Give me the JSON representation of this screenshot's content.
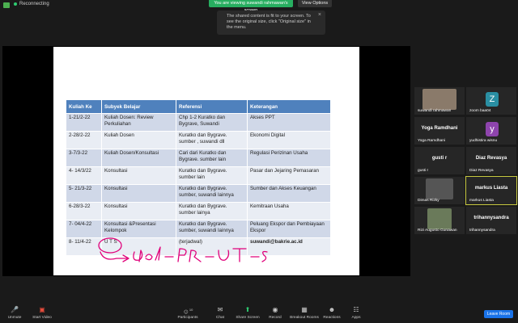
{
  "topbar": {
    "status": "Reconnecting",
    "viewing": "You are viewing suwandi rahmawan's screen",
    "view_options": "View Options"
  },
  "tooltip": {
    "text": "The shared content is fit to your screen. To see the original size, click \"Original size\" in the menu.",
    "close": "×"
  },
  "table": {
    "headers": [
      "Kuliah Ke",
      "Subyek Belajar",
      "Referensi",
      "Keterangan"
    ],
    "rows": [
      [
        "1-21/2-22",
        "Kuliah Dosen: Review Perkuliahan",
        "Chp 1-2 Kuratko dan Bygrave, Suwandi",
        "Akses  PPT"
      ],
      [
        "2-28/2-22",
        "Kuliah Dosen",
        "Kuratko dan Bygrave. sumber , suwandi dll",
        "Ekonomi Digital"
      ],
      [
        "3-7/3-22",
        "Kuliah Dosen/Konsultasi",
        "Cari dari  Kuratko dan Bygrave. sumber lain",
        "Regulasi Perizinan Usaha"
      ],
      [
        "4- 14/3/22",
        "Konsultasi",
        "Kuratko dan Bygrave. sumber lain",
        "Pasar dan Jejaring Pemasaran"
      ],
      [
        "5- 21/3-22",
        "Konsultasi",
        "Kuratko dan Bygrave. sumber, suwandi lainnya",
        "Sumber dan Akses Keuangan"
      ],
      [
        "6-28/3-22",
        "Konsultasi",
        "Kuratko dan Bygrave. sumber lainya",
        "Kemitraan Usaha"
      ],
      [
        "7- 04/4-22",
        "Konsultasi &Presentasi Kelompok",
        "Kuratko dan Bygrave. sumber, suwandi lainnya",
        "Peluang Ekspor dan Pembiayaan Ekspor"
      ],
      [
        "8- 11/4-22",
        "U T S",
        "(terjadwal)",
        "suwandi@bakrie.ac.id"
      ]
    ]
  },
  "gallery": [
    {
      "name": "suwandi rahmawan",
      "label": "",
      "avatar": "",
      "color": "#8a7a6a"
    },
    {
      "name": "zoom baa04",
      "label": "",
      "avatar": "Z",
      "color": "#2a8fa3"
    },
    {
      "name": "Yoga Ramdhani",
      "label": "Yoga Ramdhani",
      "avatar": "",
      "color": ""
    },
    {
      "name": "yudhistira wisnu",
      "label": "",
      "avatar": "y",
      "color": "#8e44ad"
    },
    {
      "name": "gusti r",
      "label": "gusti r",
      "avatar": "",
      "color": ""
    },
    {
      "name": "Diaz Revasya",
      "label": "Diaz Revasya",
      "avatar": "",
      "color": ""
    },
    {
      "name": "Dimas Rizky",
      "label": "",
      "avatar": "",
      "color": "#555"
    },
    {
      "name": "markus Liasta",
      "label": "markus Liasta",
      "avatar": "",
      "color": ""
    },
    {
      "name": "Rizi Augusto Gunawan",
      "label": "",
      "avatar": "",
      "color": "#6a7a5a"
    },
    {
      "name": "trihannysandra",
      "label": "trihannysandra",
      "avatar": "",
      "color": ""
    }
  ],
  "toolbar": {
    "unmute": "Unmute",
    "start_video": "Start Video",
    "participants": "Participants",
    "participants_count": "10",
    "chat": "Chat",
    "share_screen": "Share Screen",
    "record": "Record",
    "breakout_rooms": "Breakout Rooms",
    "reactions": "Reactions",
    "apps": "Apps",
    "leave": "Leave Room"
  },
  "colors": {
    "header_blue": "#4f81bd",
    "row_alt": "#d0d8e8",
    "green": "#27ae60",
    "leave_blue": "#1a73e8",
    "ink": "#e0007a"
  }
}
